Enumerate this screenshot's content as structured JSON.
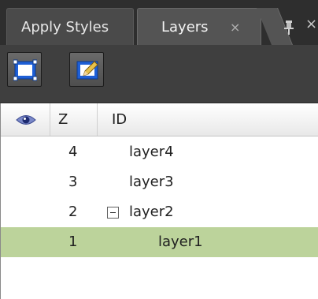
{
  "tabs": [
    {
      "label": "Apply Styles",
      "active": false
    },
    {
      "label": "Layers",
      "active": true
    }
  ],
  "tab_close_glyph": "×",
  "panel_close_glyph": "×",
  "toolbar": {
    "buttons": [
      {
        "icon": "insert-layer-icon"
      },
      {
        "icon": "edit-layer-icon"
      }
    ]
  },
  "columns": {
    "visibility_icon": "eye-icon",
    "z": "Z",
    "id": "ID"
  },
  "rows": [
    {
      "z": "4",
      "id": "layer4",
      "level": 0,
      "expander": false,
      "selected": false
    },
    {
      "z": "3",
      "id": "layer3",
      "level": 0,
      "expander": false,
      "selected": false
    },
    {
      "z": "2",
      "id": "layer2",
      "level": 0,
      "expander": true,
      "selected": false
    },
    {
      "z": "1",
      "id": "layer1",
      "level": 1,
      "expander": false,
      "selected": true
    }
  ],
  "colors": {
    "selected_row": "#bcd39b",
    "toolbar_bg": "#3f3f3f",
    "tab_strip": "#2e2e2e"
  }
}
